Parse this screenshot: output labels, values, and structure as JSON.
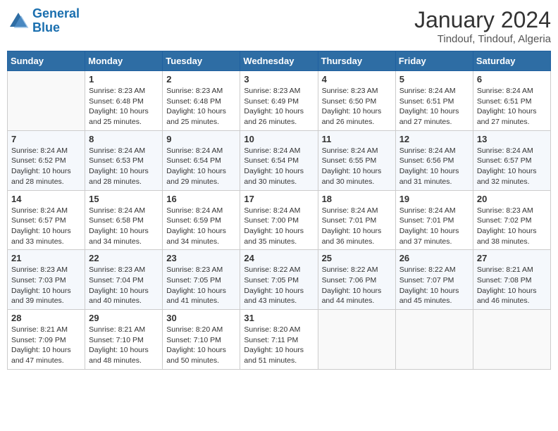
{
  "logo": {
    "line1": "General",
    "line2": "Blue"
  },
  "title": "January 2024",
  "subtitle": "Tindouf, Tindouf, Algeria",
  "weekdays": [
    "Sunday",
    "Monday",
    "Tuesday",
    "Wednesday",
    "Thursday",
    "Friday",
    "Saturday"
  ],
  "weeks": [
    [
      {
        "day": "",
        "empty": true
      },
      {
        "day": "1",
        "sunrise": "8:23 AM",
        "sunset": "6:48 PM",
        "daylight": "10 hours and 25 minutes."
      },
      {
        "day": "2",
        "sunrise": "8:23 AM",
        "sunset": "6:48 PM",
        "daylight": "10 hours and 25 minutes."
      },
      {
        "day": "3",
        "sunrise": "8:23 AM",
        "sunset": "6:49 PM",
        "daylight": "10 hours and 26 minutes."
      },
      {
        "day": "4",
        "sunrise": "8:23 AM",
        "sunset": "6:50 PM",
        "daylight": "10 hours and 26 minutes."
      },
      {
        "day": "5",
        "sunrise": "8:24 AM",
        "sunset": "6:51 PM",
        "daylight": "10 hours and 27 minutes."
      },
      {
        "day": "6",
        "sunrise": "8:24 AM",
        "sunset": "6:51 PM",
        "daylight": "10 hours and 27 minutes."
      }
    ],
    [
      {
        "day": "7",
        "sunrise": "8:24 AM",
        "sunset": "6:52 PM",
        "daylight": "10 hours and 28 minutes."
      },
      {
        "day": "8",
        "sunrise": "8:24 AM",
        "sunset": "6:53 PM",
        "daylight": "10 hours and 28 minutes."
      },
      {
        "day": "9",
        "sunrise": "8:24 AM",
        "sunset": "6:54 PM",
        "daylight": "10 hours and 29 minutes."
      },
      {
        "day": "10",
        "sunrise": "8:24 AM",
        "sunset": "6:54 PM",
        "daylight": "10 hours and 30 minutes."
      },
      {
        "day": "11",
        "sunrise": "8:24 AM",
        "sunset": "6:55 PM",
        "daylight": "10 hours and 30 minutes."
      },
      {
        "day": "12",
        "sunrise": "8:24 AM",
        "sunset": "6:56 PM",
        "daylight": "10 hours and 31 minutes."
      },
      {
        "day": "13",
        "sunrise": "8:24 AM",
        "sunset": "6:57 PM",
        "daylight": "10 hours and 32 minutes."
      }
    ],
    [
      {
        "day": "14",
        "sunrise": "8:24 AM",
        "sunset": "6:57 PM",
        "daylight": "10 hours and 33 minutes."
      },
      {
        "day": "15",
        "sunrise": "8:24 AM",
        "sunset": "6:58 PM",
        "daylight": "10 hours and 34 minutes."
      },
      {
        "day": "16",
        "sunrise": "8:24 AM",
        "sunset": "6:59 PM",
        "daylight": "10 hours and 34 minutes."
      },
      {
        "day": "17",
        "sunrise": "8:24 AM",
        "sunset": "7:00 PM",
        "daylight": "10 hours and 35 minutes."
      },
      {
        "day": "18",
        "sunrise": "8:24 AM",
        "sunset": "7:01 PM",
        "daylight": "10 hours and 36 minutes."
      },
      {
        "day": "19",
        "sunrise": "8:24 AM",
        "sunset": "7:01 PM",
        "daylight": "10 hours and 37 minutes."
      },
      {
        "day": "20",
        "sunrise": "8:23 AM",
        "sunset": "7:02 PM",
        "daylight": "10 hours and 38 minutes."
      }
    ],
    [
      {
        "day": "21",
        "sunrise": "8:23 AM",
        "sunset": "7:03 PM",
        "daylight": "10 hours and 39 minutes."
      },
      {
        "day": "22",
        "sunrise": "8:23 AM",
        "sunset": "7:04 PM",
        "daylight": "10 hours and 40 minutes."
      },
      {
        "day": "23",
        "sunrise": "8:23 AM",
        "sunset": "7:05 PM",
        "daylight": "10 hours and 41 minutes."
      },
      {
        "day": "24",
        "sunrise": "8:22 AM",
        "sunset": "7:05 PM",
        "daylight": "10 hours and 43 minutes."
      },
      {
        "day": "25",
        "sunrise": "8:22 AM",
        "sunset": "7:06 PM",
        "daylight": "10 hours and 44 minutes."
      },
      {
        "day": "26",
        "sunrise": "8:22 AM",
        "sunset": "7:07 PM",
        "daylight": "10 hours and 45 minutes."
      },
      {
        "day": "27",
        "sunrise": "8:21 AM",
        "sunset": "7:08 PM",
        "daylight": "10 hours and 46 minutes."
      }
    ],
    [
      {
        "day": "28",
        "sunrise": "8:21 AM",
        "sunset": "7:09 PM",
        "daylight": "10 hours and 47 minutes."
      },
      {
        "day": "29",
        "sunrise": "8:21 AM",
        "sunset": "7:10 PM",
        "daylight": "10 hours and 48 minutes."
      },
      {
        "day": "30",
        "sunrise": "8:20 AM",
        "sunset": "7:10 PM",
        "daylight": "10 hours and 50 minutes."
      },
      {
        "day": "31",
        "sunrise": "8:20 AM",
        "sunset": "7:11 PM",
        "daylight": "10 hours and 51 minutes."
      },
      {
        "day": "",
        "empty": true
      },
      {
        "day": "",
        "empty": true
      },
      {
        "day": "",
        "empty": true
      }
    ]
  ]
}
